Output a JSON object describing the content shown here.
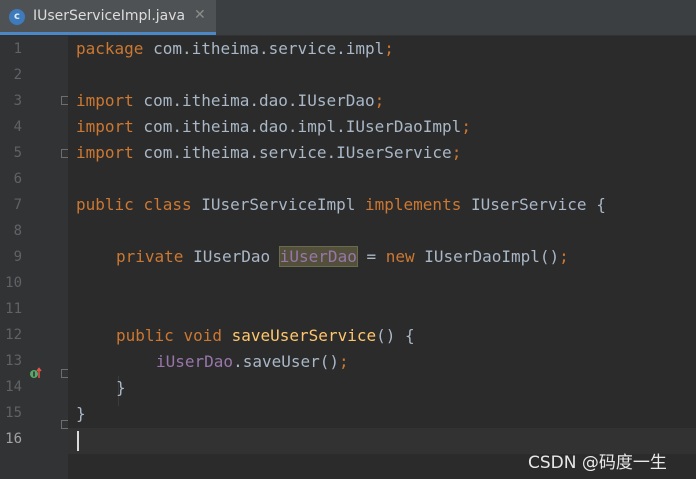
{
  "tab": {
    "icon": "java-class-icon",
    "icon_letter": "c",
    "title": "IUserServiceImpl.java",
    "close": "✕"
  },
  "gutter": {
    "line_numbers": [
      "1",
      "2",
      "3",
      "4",
      "5",
      "6",
      "7",
      "8",
      "9",
      "10",
      "11",
      "12",
      "13",
      "14",
      "15",
      "16"
    ],
    "current_line": 16,
    "marker_icon": "implements-method-icon"
  },
  "code": {
    "l1": {
      "kw": "package",
      "rest": " com.itheima.service.impl",
      "semi": ";"
    },
    "l3": {
      "kw": "import",
      "rest": " com.itheima.dao.IUserDao",
      "semi": ";"
    },
    "l4": {
      "kw": "import",
      "rest": " com.itheima.dao.impl.IUserDaoImpl",
      "semi": ";"
    },
    "l5": {
      "kw": "import",
      "rest": " com.itheima.service.IUserService",
      "semi": ";"
    },
    "l7": {
      "kw1": "public",
      "kw2": "class",
      "name": " IUserServiceImpl ",
      "kw3": "implements",
      "rest": " IUserService {"
    },
    "l9": {
      "kw": "private",
      "type": " IUserDao ",
      "field": "iUserDao",
      "eq": " = ",
      "kw2": "new",
      "rest": " IUserDaoImpl()",
      "semi": ";"
    },
    "l12": {
      "kw1": "public",
      "kw2": "void",
      "fn": "saveUserService",
      "rest": "() {"
    },
    "l13": {
      "field": "iUserDao",
      "rest": ".saveUser()",
      "semi": ";"
    },
    "l14": {
      "text": "}"
    },
    "l15": {
      "text": "}"
    }
  },
  "watermark": "CSDN @码度一生",
  "colors": {
    "keyword": "#cc7832",
    "method": "#ffc66d",
    "field": "#9876aa",
    "text": "#a9b7c6",
    "background": "#2b2b2b"
  }
}
